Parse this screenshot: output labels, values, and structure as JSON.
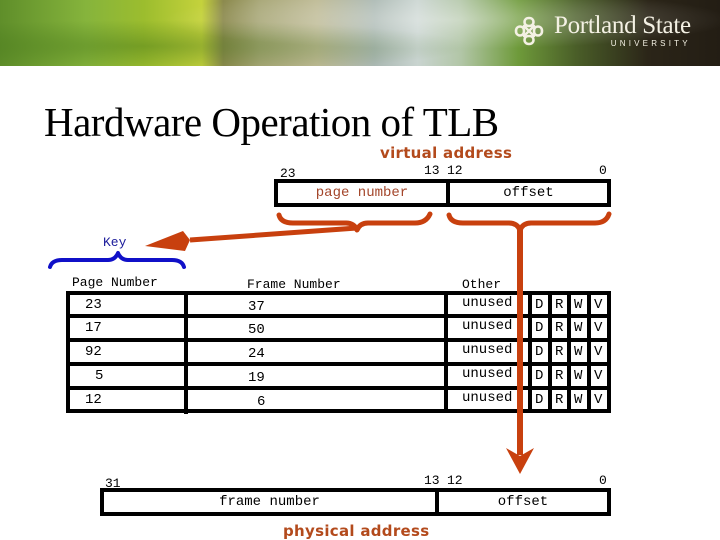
{
  "header": {
    "logo_name": "Portland State",
    "logo_sub": "UNIVERSITY"
  },
  "slide": {
    "title": "Hardware Operation of TLB"
  },
  "virtual_address": {
    "caption": "virtual address",
    "bit_high": "23",
    "bit_split_high": "13",
    "bit_split_low": "12",
    "bit_low": "0",
    "fields": [
      "page number",
      "offset"
    ]
  },
  "tlb": {
    "key_label": "Key",
    "headers": [
      "Page Number",
      "Frame Number",
      "Other"
    ],
    "rows": [
      {
        "page": "23",
        "frame": "37",
        "other": "unused",
        "flags": [
          "D",
          "R",
          "W",
          "V"
        ]
      },
      {
        "page": "17",
        "frame": "50",
        "other": "unused",
        "flags": [
          "D",
          "R",
          "W",
          "V"
        ]
      },
      {
        "page": "92",
        "frame": "24",
        "other": "unused",
        "flags": [
          "D",
          "R",
          "W",
          "V"
        ]
      },
      {
        "page": "5",
        "frame": "19",
        "other": "unused",
        "flags": [
          "D",
          "R",
          "W",
          "V"
        ]
      },
      {
        "page": "12",
        "frame": "6",
        "other": "unused",
        "flags": [
          "D",
          "R",
          "W",
          "V"
        ]
      }
    ]
  },
  "physical_address": {
    "caption": "physical address",
    "bit_high": "31",
    "bit_split_high": "13",
    "bit_split_low": "12",
    "bit_low": "0",
    "fields": [
      "frame number",
      "offset"
    ]
  },
  "colors": {
    "arrow": "#c8400e",
    "key_brace": "#1010c8",
    "caption": "#b34a1c"
  }
}
